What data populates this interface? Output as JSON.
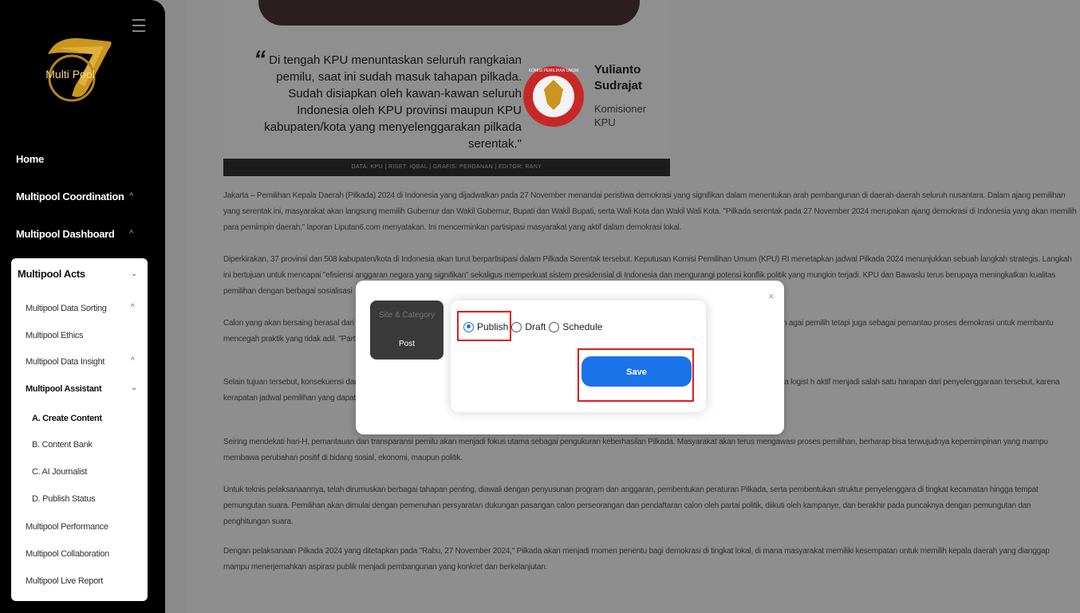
{
  "sidebar": {
    "logo_text": "Multi Pool",
    "home": "Home",
    "coordination": "Multipool Coordination",
    "dashboard": "Multipool Dashboard",
    "acts": {
      "title": "Multipool Acts",
      "items": {
        "data_sorting": "Multipool Data Sorting",
        "ethics": "Multipool Ethics",
        "data_insight": "Multipool Data Insight",
        "assistant": "Multipool Assistant",
        "create_content": "A. Create Content",
        "content_bank": "B. Content Bank",
        "ai_journalist": "C. AI Journalist",
        "publish_status": "D. Publish Status",
        "performance": "Multipool Performance",
        "collaboration": "Multipool Collaboration",
        "live_report": "Multipool Live Report"
      }
    }
  },
  "article": {
    "quote": "Di tengah KPU menuntaskan seluruh rangkaian pemilu, saat ini sudah masuk tahapan pilkada. Sudah disiapkan oleh kawan-kawan seluruh Indonesia oleh KPU provinsi maupun KPU kabupaten/kota yang menyelenggarakan pilkada serentak.\"",
    "quote_mark": "“",
    "person_name": "Yulianto Sudrajat",
    "person_role": "Komisioner KPU",
    "emblem_text": "KOMISI PEMILIHAN UMUM",
    "credits": "DATA: KPU | RISET: IQBAL | GRAFIS: PERDANAN | EDITOR: RANY",
    "paragraphs": [
      "Jakarta – Pemilihan Kepala Daerah (Pilkada) 2024 di Indonesia yang dijadwalkan pada 27 November menandai peristiwa demokrasi yang signifikan dalam menentukan arah pembangunan di daerah-daerah seluruh nusantara. Dalam ajang pemilihan yang serentak ini, masyarakat akan langsung memilih Gubernur dan Wakil Gubernur, Bupati dan Wakil Bupati, serta Wali Kota dan Wakil Wali Kota. \"Pilkada serentak pada 27 November 2024 merupakan ajang demokrasi di Indonesia yang akan memilih para pemimpin daerah,\" laporan Liputan6.com menyatakan. Ini mencerminkan partisipasi masyarakat yang aktif dalam demokrasi lokal.",
      "Diperkirakan, 37 provinsi dan 508 kabupaten/kota di Indonesia akan turut berpartisipasi dalam Pilkada Serentak tersebut. Keputusan Komisi Pemilihan Umum (KPU) RI menetapkan jadwal Pilkada 2024 menunjukkan sebuah langkah strategis. Langkah ini bertujuan untuk mencapai \"efisiensi anggaran negara yang signifikan\" sekaligus memperkuat sistem presidensial di Indonesia dan mengurangi potensi konflik politik yang mungkin terjadi. KPU dan Bawaslu terus berupaya meningkatkan kualitas pemilihan dengan berbagai sosialisasi",
      "Calon yang akan bersaing berasal dari berbagai                                                                                                                                                                                     awa visi, misi, dan program unggulan mereka. Berbagai partai politik mulai merancang strategi kampanye politik, mem                                                                                                                                                    agai pemilih tetapi juga sebagai pemantau proses demokrasi untuk membantu mencegah praktik yang tidak adil. \"Partisipasi",
      "Selain tujuan tersebut, konsekuensi dari pe                                                                                                                                                                                     laan logistik dan sumber daya lainnya. \"Dengan menggabungkan dua pemilihan besar, pemerintah dapat menghemat biaya logist                                                                                                                                                h aktif menjadi salah satu harapan dari penyelenggaraan tersebut, karena kerapatan jadwal pemilihan yang dapat mengurangi k",
      "Seiring mendekati hari-H, pemantauan dan transparansi pemilu akan menjadi fokus utama sebagai pengukuran keberhasilan Pilkada. Masyarakat akan terus mengawasi proses pemilihan, berharap bisa terwujudnya kepemimpinan yang mampu membawa perubahan positif di bidang sosial, ekonomi, maupun politik.",
      "Untuk teknis pelaksanaannya, telah dirumuskan berbagai tahapan penting, diawali dengan penyusunan program dan anggaran, pembentukan peraturan Pilkada, serta pembentukan struktur penyelenggara di tingkat kecamatan hingga tempat pemungutan suara. Pemilihan akan dimulai dengan pemenuhan persyaratan dukungan pasangan calon perseorangan dan pendaftaran calon oleh partai politik, diikuti oleh kampanye, dan berakhir pada puncaknya dengan pemungutan dan penghitungan suara.",
      "Dengan pelaksanaan Pilkada 2024 yang ditetapkan pada \"Rabu, 27 November 2024,\" Pilkada akan menjadi momen penentu bagi demokrasi di tingkat lokal, di mana masyarakat memiliki kesempatan untuk memilih kepala daerah yang dianggap mampu menerjemahkan aspirasi publik menjadi pembangunan yang konkret dan berkelanjutan."
    ]
  },
  "modal": {
    "close": "×",
    "tabs": {
      "site_category": "Site & Category",
      "post": "Post"
    },
    "options": {
      "publish": "Publish",
      "draft": "Draft",
      "schedule": "Schedule"
    },
    "selected_option": "Publish",
    "save_label": "Save"
  },
  "colors": {
    "accent": "#1a73e8",
    "highlight": "#e21b1b",
    "logo_gold": "#d9a52a"
  }
}
